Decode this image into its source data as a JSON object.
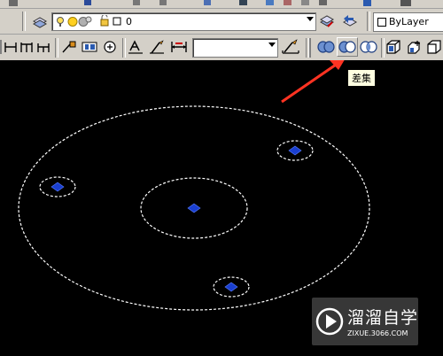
{
  "toolbar": {
    "layer_name": "0",
    "lineweight": "ByLayer",
    "tooltip": "差集"
  },
  "watermark": {
    "title": "溜溜自学",
    "url": "ZIXUE.3066.COM"
  },
  "colors": {
    "background": "#000000",
    "toolbar": "#d4d0c8",
    "circle": "#ffffff",
    "grip": "#1a3fd0",
    "arrow": "#ff3322"
  },
  "drawing": {
    "circle_style": "dashed",
    "selected": true,
    "circles": 5,
    "grips": 4
  }
}
